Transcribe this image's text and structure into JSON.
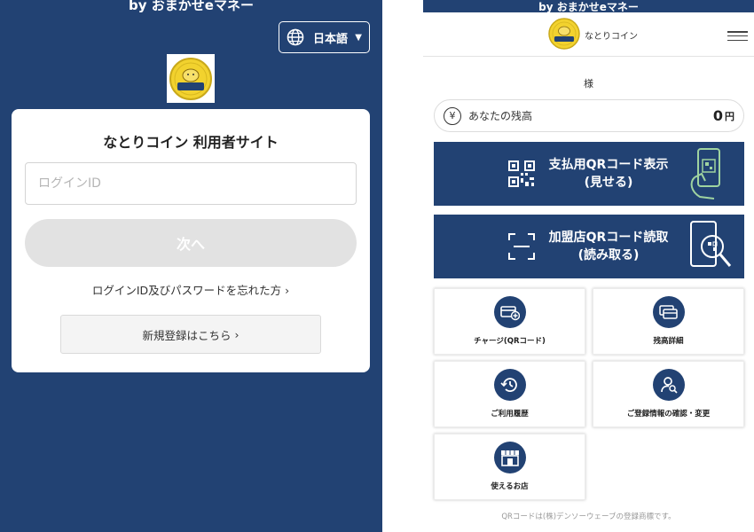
{
  "left": {
    "brand": "by おまかせeマネー",
    "language": {
      "label": "日本語",
      "icon": "globe-icon"
    },
    "logo_text": "なとりコイン",
    "card": {
      "title": "なとりコイン 利用者サイト",
      "login_placeholder": "ログインID",
      "next_label": "次へ",
      "forgot_label": "ログインID及びパスワードを忘れた方",
      "register_label": "新規登録はこちら"
    }
  },
  "right": {
    "brand": "by おまかせeマネー",
    "app_name": "なとりコイン",
    "user_suffix": "様",
    "balance": {
      "icon": "¥",
      "label": "あなたの残高",
      "amount": "0",
      "unit": "円"
    },
    "pay_qr": {
      "line1": "支払用QRコード表示",
      "line2": "(見せる)"
    },
    "scan_qr": {
      "line1": "加盟店QRコード読取",
      "line2": "(読み取る)"
    },
    "tiles": [
      {
        "label": "チャージ(QRコード)",
        "icon": "charge-card-icon"
      },
      {
        "label": "残高詳細",
        "icon": "cards-icon"
      },
      {
        "label": "ご利用履歴",
        "icon": "history-icon"
      },
      {
        "label": "ご登録情報の確認・変更",
        "icon": "user-search-icon"
      },
      {
        "label": "使えるお店",
        "icon": "store-icon"
      }
    ],
    "footnote": "QRコードは(株)デンソーウェーブの登録商標です。"
  },
  "colors": {
    "navy": "#224273",
    "gold": "#f2d22e",
    "button_disabled": "#e2e2e2"
  }
}
